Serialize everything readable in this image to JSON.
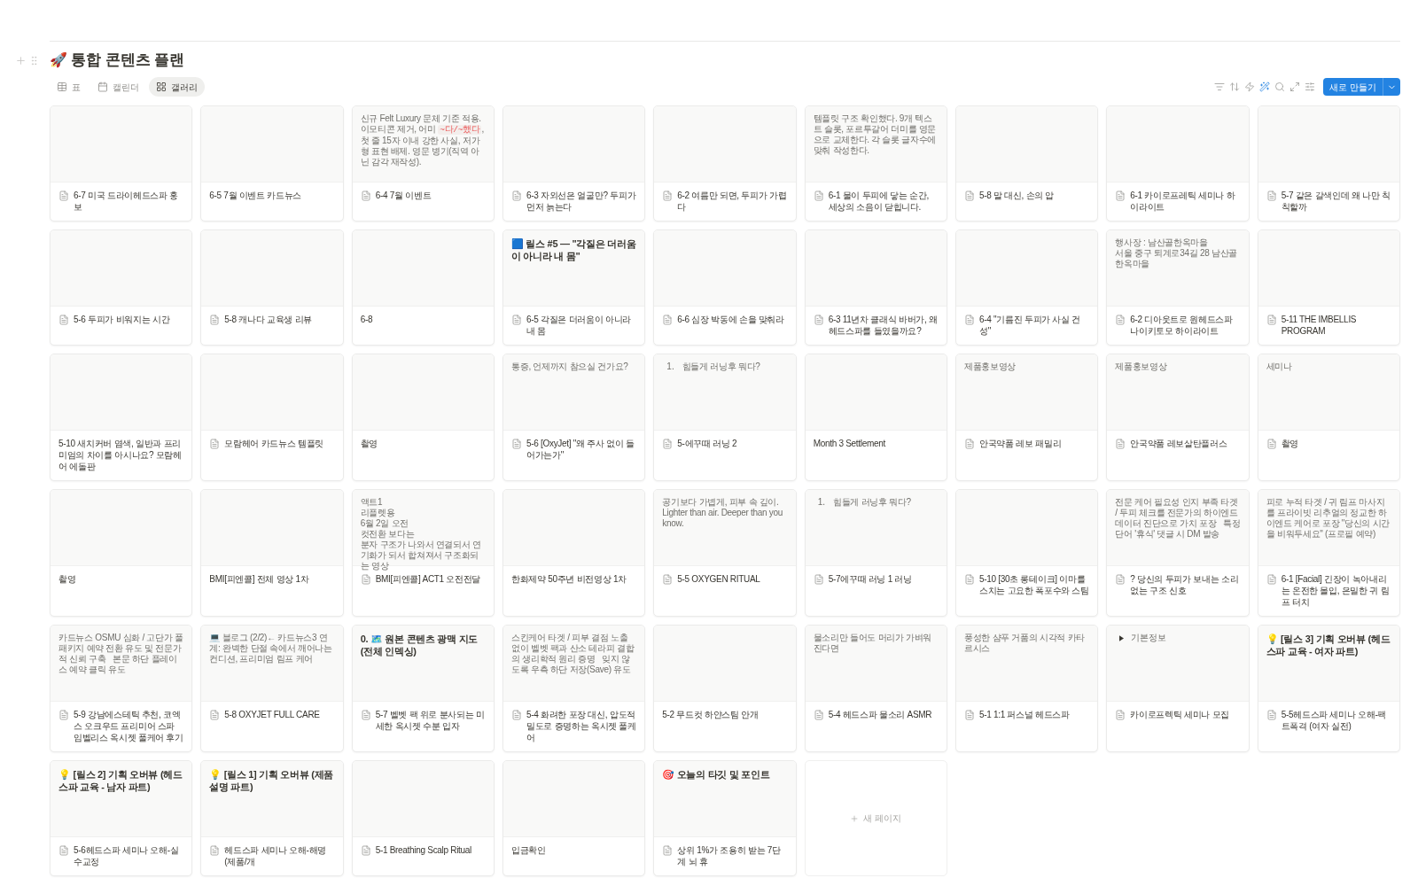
{
  "page": {
    "icon": "🚀",
    "title": "통합 콘텐츠 플랜"
  },
  "views": [
    {
      "kind": "table",
      "label": "표",
      "selected": false
    },
    {
      "kind": "calendar",
      "label": "캘린더",
      "selected": false
    },
    {
      "kind": "gallery",
      "label": "갤러리",
      "selected": true
    }
  ],
  "new_button": {
    "label": "새로 만들기"
  },
  "cards": [
    {
      "title": "6-7 미국 드라이헤드스파 홍보",
      "doc_icon": true
    },
    {
      "title": "6-5 7월 이벤트 카드뉴스",
      "doc_icon": false
    },
    {
      "title": "6-4 7월 이벤트",
      "doc_icon": true,
      "preview": {
        "kind": "code_note",
        "before": "신규 Felt Luxury 문체 기준 적용. 이모티콘 제거, 어미 ",
        "code": "~다/~했다",
        "after": ", 첫 줄 15자 이내 강한 사실, 저가형 표현 배제. 영문 병기(직역 아닌 감각 재작성)."
      }
    },
    {
      "title": "6-3 자외선은 얼굴만? 두피가 먼저 늙는다",
      "doc_icon": true
    },
    {
      "title": "6-2 여름만 되면, 두피가 가렵다",
      "doc_icon": true
    },
    {
      "title": "6-1 물이 두피에 닿는 순간, 세상의 소음이 닫힙니다.",
      "doc_icon": true,
      "preview": {
        "kind": "text",
        "lines": [
          "템플릿 구조 확인했다. 9개 텍스트 슬롯, 포르투갈어 더미를 영문으로 교체한다. 각 슬롯 글자수에 맞춰 작성한다."
        ]
      }
    },
    {
      "title": "5-8 말 대신, 손의 압",
      "doc_icon": true
    },
    {
      "title": "6-1 카이로프레틱 세미나 하이라이트",
      "doc_icon": true
    },
    {
      "title": "5-7 같은 갈색인데 왜 나만 칙칙할까",
      "doc_icon": true
    },
    {
      "title": "5-6 두피가 비워지는 시간",
      "doc_icon": true
    },
    {
      "title": "5-8 캐나다 교육생 리뷰",
      "doc_icon": true
    },
    {
      "title": "6-8",
      "doc_icon": false
    },
    {
      "title": "6-5 각질은 더러움이 아니라 내 몸",
      "doc_icon": true,
      "preview": {
        "kind": "heading",
        "text": "🟦 릴스 #5 — \"각질은 더러움이 아니라 내 몸\""
      }
    },
    {
      "title": "6-6 심장 박동에 손을 맞춰라",
      "doc_icon": true
    },
    {
      "title": "6-3 11년차 클래식 바버가, 왜 헤드스파를 들였을까요?",
      "doc_icon": true
    },
    {
      "title": "6-4 \"기름진 두피가 사실 건성\"",
      "doc_icon": true
    },
    {
      "title": "6-2 디아웃트로 원헤드스파 나이키토모 하이라이트",
      "doc_icon": true,
      "preview": {
        "kind": "text",
        "lines": [
          "행사장 : 남산골한옥마을",
          "서울 중구 퇴계로34길 28 남산골한옥마을"
        ]
      }
    },
    {
      "title": "5-11 THE IMBELLIS PROGRAM",
      "doc_icon": true
    },
    {
      "title": "5-10 새치커버 염색, 일반과 프리미엄의 차이를 아시나요? 모람헤어 에돌판",
      "doc_icon": false
    },
    {
      "title": "모람헤어 카드뉴스 템플릿",
      "doc_icon": true
    },
    {
      "title": "촬영",
      "doc_icon": false
    },
    {
      "title": "5-6 [OxyJet] \"왜 주사 없이 들어가는가\"",
      "doc_icon": true,
      "preview": {
        "kind": "text",
        "lines": [
          "통증, 언제까지 참으실 건가요?"
        ]
      }
    },
    {
      "title": "5-에꾸때 러닝 2",
      "doc_icon": true,
      "preview": {
        "kind": "numbered",
        "number": "1.",
        "text": "힘들게 러닝후 뭐다?"
      }
    },
    {
      "title": "Month 3 Settlement",
      "doc_icon": false
    },
    {
      "title": "안국약품 레보 패밀리",
      "doc_icon": true,
      "preview": {
        "kind": "text",
        "lines": [
          "제품홍보영상"
        ]
      }
    },
    {
      "title": "안국약품 레보살탄플러스",
      "doc_icon": true,
      "preview": {
        "kind": "text",
        "lines": [
          "제품홍보영상"
        ]
      }
    },
    {
      "title": "촬영",
      "doc_icon": true,
      "preview": {
        "kind": "text",
        "lines": [
          "세미나"
        ]
      }
    },
    {
      "title": "촬영",
      "doc_icon": false
    },
    {
      "title": "BMI[피엔콜] 전체 영상 1차",
      "doc_icon": false
    },
    {
      "title": "BMI[피엔콜] ACT1 오전전달",
      "doc_icon": true,
      "preview": {
        "kind": "text",
        "lines": [
          "액트1",
          "리플렛용",
          "6월 2일 오전",
          "컷전환 보다는",
          "분자 구조가 나와서 연결되서 연기화가 되서 합쳐져서 구조화되는 영상"
        ]
      }
    },
    {
      "title": "한화제약 50주년 비전영상 1차",
      "doc_icon": false
    },
    {
      "title": "5-5 OXYGEN RITUAL",
      "doc_icon": true,
      "preview": {
        "kind": "text",
        "lines": [
          "공기보다 가볍게, 피부 속 깊이.",
          "Lighter than air. Deeper than you know."
        ]
      }
    },
    {
      "title": "5-7에꾸때 러닝 1 러닝",
      "doc_icon": true,
      "preview": {
        "kind": "numbered",
        "number": "1.",
        "text": "힘들게 러닝후 뭐다?"
      }
    },
    {
      "title": "5-10 [30초 롱테이크] 이마를 스치는 고요한 폭포수와 스팀",
      "doc_icon": true
    },
    {
      "title": "? 당신의 두피가 보내는 소리 없는 구조 신호",
      "doc_icon": true,
      "preview": {
        "kind": "text",
        "lines": [
          "전문 케어 필요성 인지 부족 타겟 / 두피 체크를 전문가의 하이엔드 데이터 진단으로 가치 포장   특정 단어 '휴식' 댓글 시 DM 발송"
        ]
      }
    },
    {
      "title": "6-1 [Facial] 긴장이 녹아내리는 온전한 몰입, 은밀한 귀 림프 터치",
      "doc_icon": true,
      "preview": {
        "kind": "text",
        "lines": [
          "피로 누적 타겟 / 귀 림프 마사지를 프라이빗 리추얼의 정교한 하이엔드 케어로 포장 \"당신의 시간을 비워두세요\" (프로필 예약)"
        ]
      }
    },
    {
      "title": "5-9 강남에스테틱 추천, 코엑스 오크우드 프리미어 스파 임벨리스 옥시젯 풀케어 후기",
      "doc_icon": true,
      "preview": {
        "kind": "text",
        "lines": [
          "카드뉴스 OSMU 심화 / 고단가 풀 패키지 예약 전환 유도 및 전문가적 신뢰 구축   본문 하단 플레이스 예약 클릭 유도"
        ]
      }
    },
    {
      "title": "5-8 OXYJET FULL CARE",
      "doc_icon": true,
      "preview": {
        "kind": "text",
        "lines": [
          "💻 블로그 (2/2)← 카드뉴스3 연계: 완벽한 단절 속에서 깨어나는 컨디션, 프리미엄 림프 케어"
        ]
      }
    },
    {
      "title": "5-7 벨벳 팩 위로 분사되는 미세한 옥시젯 수분 입자",
      "doc_icon": true,
      "preview": {
        "kind": "heading",
        "text": "0. 🗺️ 원본 콘텐츠 광맥 지도 (전체 인덱싱)"
      }
    },
    {
      "title": "5-4 화려한 포장 대신, 압도적 밀도로 증명하는 옥시젯 풀케어",
      "doc_icon": true,
      "preview": {
        "kind": "text",
        "lines": [
          "스킨케어 타겟 / 피부 결점 노출 없이 벨벳 팩과 산소 테라피 결합의 생리학적 원리 증명   잊지 않도록 우측 하단 저장(Save) 유도"
        ]
      }
    },
    {
      "title": "5-2 무드컷 하얀스팀 안개",
      "doc_icon": false
    },
    {
      "title": "5-4 헤드스파 물소리 ASMR",
      "doc_icon": true,
      "preview": {
        "kind": "text",
        "lines": [
          "물소리만 들어도 머리가 가벼워진다면"
        ]
      }
    },
    {
      "title": "5-1 1:1 퍼스널 헤드스파",
      "doc_icon": true,
      "preview": {
        "kind": "text",
        "lines": [
          "풍성한 샴푸 거품의 시각적 카타르시스"
        ]
      }
    },
    {
      "title": "카이로프렉틱 세미나 모집",
      "doc_icon": true,
      "preview": {
        "kind": "toggle",
        "text": "기본정보"
      }
    },
    {
      "title": "5-5헤드스파 세미나 오해-팩트폭격 (여자 실전)",
      "doc_icon": true,
      "preview": {
        "kind": "heading",
        "text": "💡 [릴스 3] 기획 오버뷰 (헤드스파 교육 - 여자 파트)"
      }
    },
    {
      "title": "5-6헤드스파 세미나 오해-실수교정",
      "doc_icon": true,
      "preview": {
        "kind": "heading",
        "text": "💡 [릴스 2] 기획 오버뷰 (헤드스파 교육 - 남자 파트)"
      }
    },
    {
      "title": "헤드스파 세미나 오해-해명 (제품/개",
      "doc_icon": true,
      "preview": {
        "kind": "heading",
        "text": "💡 [릴스 1] 기획 오버뷰 (제품 설명 파트)"
      }
    },
    {
      "title": "5-1 Breathing Scalp Ritual",
      "doc_icon": true
    },
    {
      "title": "입금확인",
      "doc_icon": false
    },
    {
      "title": "상위 1%가 조용히 받는 7단계 뇌 휴",
      "doc_icon": true,
      "preview": {
        "kind": "heading",
        "text": "🎯 오늘의 타깃 및 포인트"
      }
    }
  ],
  "new_page": {
    "label": "새 페이지"
  }
}
